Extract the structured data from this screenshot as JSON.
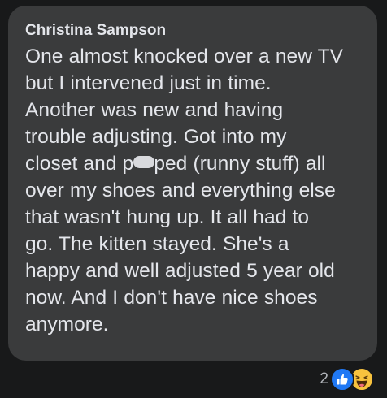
{
  "comment": {
    "author": "Christina Sampson",
    "lines": [
      "One almost knocked over a new TV",
      "but I intervened just in time.",
      "Another was new and having",
      "trouble adjusting. Got into my",
      {
        "before": "closet and p",
        "after": "ped (runny stuff) all"
      },
      "over my shoes and everything else",
      "that wasn't hung up. It all had to",
      "go. The kitten stayed. She's a",
      "happy and well adjusted 5 year old",
      "now. And I don't have nice shoes",
      "anymore."
    ]
  },
  "reactions": {
    "count": "2",
    "types": [
      "like-icon",
      "haha-icon"
    ]
  },
  "colors": {
    "background": "#18191a",
    "bubble": "#3a3b3c",
    "text": "#e4e6eb",
    "secondary_text": "#b0b3b8",
    "like_blue": "#2078f4",
    "haha_yellow": "#f7c23e"
  }
}
